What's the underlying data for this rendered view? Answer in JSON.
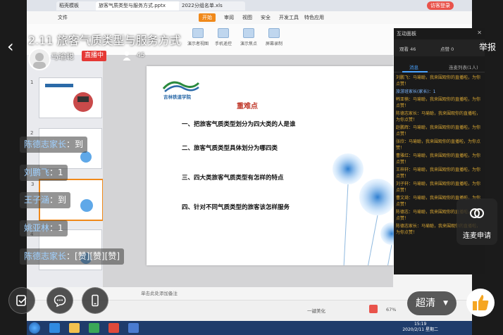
{
  "live": {
    "title": "2.11 旅客气质类型与服务方式",
    "host_name": "马瑜聪",
    "live_badge": "直播中",
    "viewer_count": "45",
    "report": "举报"
  },
  "wps": {
    "tabs": [
      "稻壳模板",
      "旅客气质类型与服务方式.pptx",
      "2022分组名单.xls"
    ],
    "login": "访客登录",
    "menu": [
      "文件",
      "开始",
      "插入",
      "设计",
      "切换",
      "动画",
      "幻灯片放映",
      "审阅",
      "视图",
      "安全",
      "开发工具",
      "特色应用"
    ],
    "ribbon": [
      "演示者视图",
      "手机遥控",
      "演示焦点",
      "屏幕录制"
    ],
    "notes_placeholder": "单击此处添加备注",
    "zoom": "67%",
    "smart": "一键美化"
  },
  "slide": {
    "logo_text": "吉林铁道学院",
    "title": "重难点",
    "points": [
      "一、把旅客气质类型划分为四大类的人是谁",
      "二、旅客气质类型具体划分为哪四类",
      "三、四大类旅客气质类型有怎样的特点",
      "四、针对不同气质类型的旅客该怎样服务"
    ]
  },
  "chat": {
    "title": "互动面板",
    "stats": [
      "观看 46",
      "点赞 0"
    ],
    "tabs": [
      "消息",
      "连麦列表(1人)"
    ],
    "messages": [
      {
        "text": "刘鹏飞：马瑜聪，我来围观你的直播啦，为你点赞！",
        "color": "orange"
      },
      {
        "text": "旅游班家长(家长)：1",
        "color": "blue"
      },
      {
        "text": "韩亚楠：马瑜聪，我来围观你的直播啦，为你点赞！",
        "color": "orange"
      },
      {
        "text": "陈德志家长：马瑜聪，我来围观你的直播啦，为你点赞！",
        "color": "orange"
      },
      {
        "text": "赵鹏辉：马瑜聪，我来围观你的直播啦，为你点赞！",
        "color": "orange"
      },
      {
        "text": "张欣：马瑜聪，我来围观你的直播啦，为你点赞！",
        "color": "orange"
      },
      {
        "text": "曹雅红：马瑜聪，我来围观你的直播啦，为你点赞！",
        "color": "orange"
      },
      {
        "text": "王梓轩：马瑜聪，我来围观你的直播啦，为你点赞！",
        "color": "orange"
      },
      {
        "text": "刘子轩：马瑜聪，我来围观你的直播啦，为你点赞！",
        "color": "orange"
      },
      {
        "text": "曹文琦：马瑜聪，我来围观你的直播啦，为你点赞！",
        "color": "orange"
      },
      {
        "text": "陈德志：马瑜聪，我来围观你的直播啦，为你点赞！",
        "color": "orange"
      },
      {
        "text": "陈德志家长：马瑜聪，我来围观你的直播啦，为你点赞！",
        "color": "orange"
      }
    ]
  },
  "danmaku": [
    {
      "name": "陈德志家长",
      "text": "：到"
    },
    {
      "name": "刘鹏飞",
      "text": "：1"
    },
    {
      "name": "王子涵",
      "text": "：到"
    },
    {
      "name": "姚亚林",
      "text": "：1"
    },
    {
      "name": "陈德志家长",
      "text": "：[赞][赞][赞]"
    }
  ],
  "controls": {
    "lianmai": "连麦申请",
    "quality": "超清"
  },
  "taskbar": {
    "time": "15:19",
    "date": "2020/2/11 星期二"
  },
  "colors": {
    "live_red": "#e53935",
    "accent_orange": "#f0891a",
    "chat_blue": "#4aa3ff",
    "chat_orange": "#d9a733"
  }
}
